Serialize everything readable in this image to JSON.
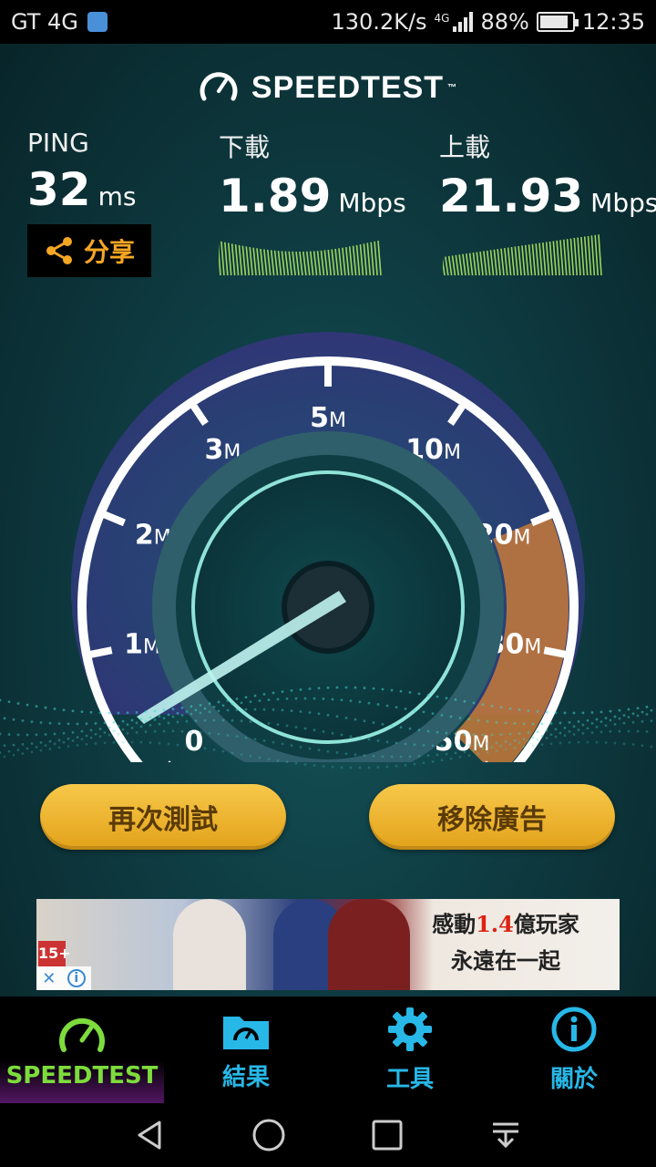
{
  "status_bar": {
    "carrier": "GT 4G",
    "speed": "130.2K/s",
    "network": "4G",
    "battery": "88%",
    "time": "12:35"
  },
  "app": {
    "logo": "SPEEDTEST",
    "logo_tm": "™"
  },
  "ping": {
    "label": "PING",
    "value": "32",
    "unit": "ms"
  },
  "download": {
    "label": "下載",
    "value": "1.89",
    "unit": "Mbps"
  },
  "upload": {
    "label": "上載",
    "value": "21.93",
    "unit": "Mbps"
  },
  "share": {
    "label": "分享",
    "icon": "share-icon"
  },
  "gauge": {
    "ticks": [
      {
        "num": "0",
        "unit": ""
      },
      {
        "num": "1",
        "unit": "M"
      },
      {
        "num": "2",
        "unit": "M"
      },
      {
        "num": "3",
        "unit": "M"
      },
      {
        "num": "5",
        "unit": "M"
      },
      {
        "num": "10",
        "unit": "M"
      },
      {
        "num": "20",
        "unit": "M"
      },
      {
        "num": "30",
        "unit": "M"
      },
      {
        "num": "50",
        "unit": "M"
      }
    ],
    "needle_value": "0",
    "accent_color": "#c87a3a",
    "arc_color": "#b58be0"
  },
  "buttons": {
    "retest": "再次測試",
    "remove_ads": "移除廣告"
  },
  "ad": {
    "age": "15+",
    "line1_a": "感動",
    "line1_b": "1.4",
    "line1_c": "億玩家",
    "line2": "永遠在一起",
    "close": "✕",
    "info": "i"
  },
  "tabs": [
    {
      "label": "SPEEDTEST",
      "icon": "speedometer-icon",
      "active": true
    },
    {
      "label": "結果",
      "icon": "results-folder-icon",
      "active": false
    },
    {
      "label": "工具",
      "icon": "gear-icon",
      "active": false
    },
    {
      "label": "關於",
      "icon": "info-icon",
      "active": false
    }
  ],
  "colors": {
    "brand_gold": "#f0b431",
    "tab_blue": "#27b8e8",
    "tab_active_green": "#7ddc3c"
  }
}
